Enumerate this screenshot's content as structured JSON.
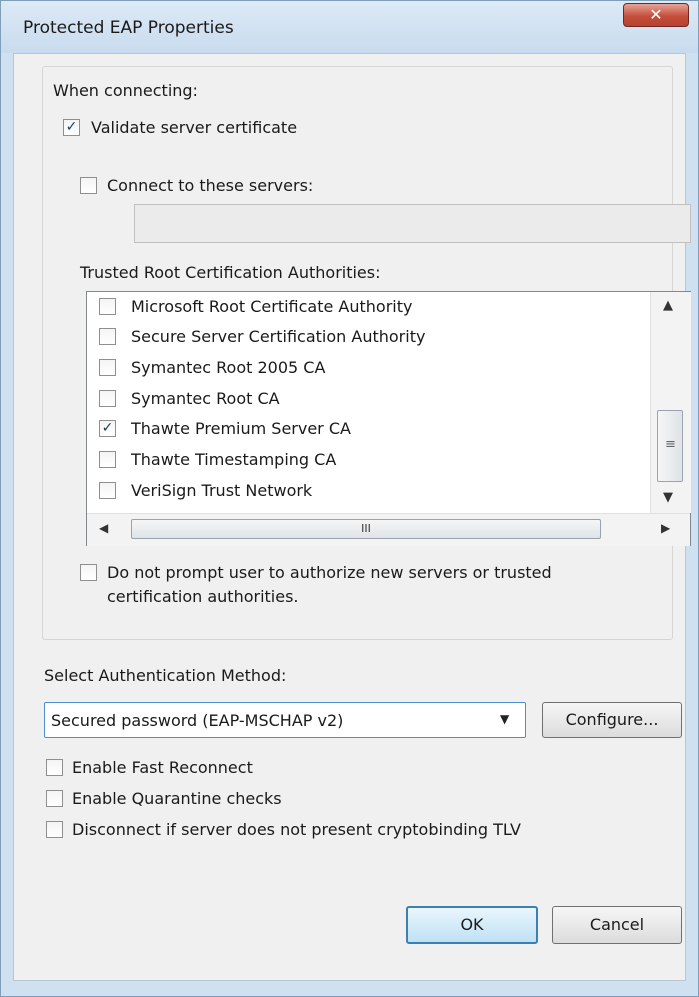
{
  "window": {
    "title": "Protected EAP Properties",
    "close_label": "✕"
  },
  "connecting": {
    "heading": "When connecting:",
    "validate_cert": {
      "label": "Validate server certificate",
      "checked": true
    },
    "connect_servers": {
      "label": "Connect to these servers:",
      "checked": false,
      "value": ""
    },
    "trusted_heading": "Trusted Root Certification Authorities:",
    "authorities": [
      {
        "label": "Microsoft Root Certificate Authority",
        "checked": false
      },
      {
        "label": "Secure Server Certification Authority",
        "checked": false
      },
      {
        "label": "Symantec Root 2005 CA",
        "checked": false
      },
      {
        "label": "Symantec Root CA",
        "checked": false
      },
      {
        "label": "Thawte Premium Server CA",
        "checked": true
      },
      {
        "label": "Thawte Timestamping CA",
        "checked": false
      },
      {
        "label": "VeriSign Trust Network",
        "checked": false
      }
    ],
    "no_prompt": {
      "label_line1": "Do not prompt user to authorize new servers or trusted",
      "label_line2": "certification authorities.",
      "checked": false
    }
  },
  "auth": {
    "heading": "Select Authentication Method:",
    "selected": "Secured password (EAP-MSCHAP v2)",
    "configure_label": "Configure..."
  },
  "options": [
    {
      "label": "Enable Fast Reconnect",
      "checked": false
    },
    {
      "label": "Enable Quarantine checks",
      "checked": false
    },
    {
      "label": "Disconnect if server does not present cryptobinding TLV",
      "checked": false
    }
  ],
  "buttons": {
    "ok": "OK",
    "cancel": "Cancel"
  },
  "icons": {
    "check": "✓",
    "scroll_up": "▲",
    "scroll_down": "▼",
    "scroll_left": "◀",
    "scroll_right": "▶",
    "grip_v": "≡",
    "grip_h": "III",
    "dropdown": "▼"
  }
}
